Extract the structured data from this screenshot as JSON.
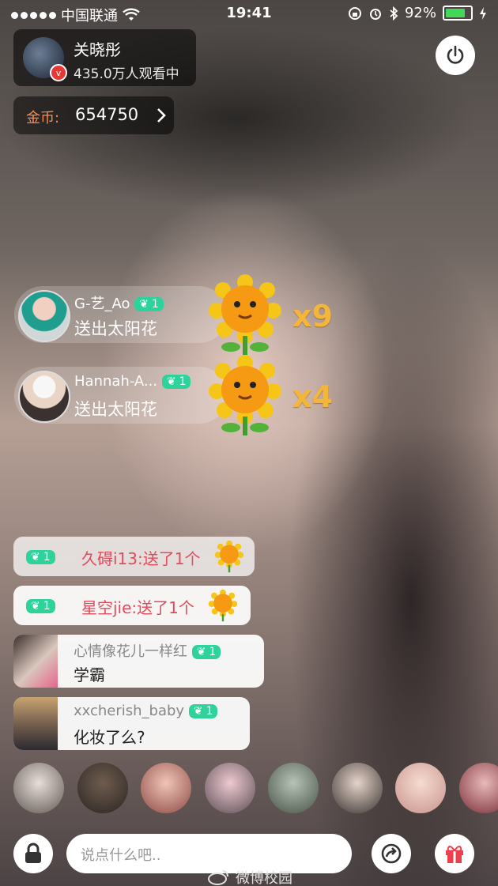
{
  "status_bar": {
    "carrier": "中国联通",
    "time": "19:41",
    "battery": "92%",
    "battery_level": 0.92
  },
  "host": {
    "name": "关晓彤",
    "viewers": "435.0万人观看中"
  },
  "coins": {
    "label": "金币:",
    "value": "654750"
  },
  "gift_notifications": [
    {
      "username": "G-艺_Ao",
      "level": "1",
      "message": "送出太阳花",
      "count": "x9"
    },
    {
      "username": "Hannah-A...",
      "level": "1",
      "message": "送出太阳花",
      "count": "x4"
    }
  ],
  "system_messages": [
    {
      "level": "1",
      "text": "久碍i13:送了1个"
    },
    {
      "level": "1",
      "text": "星空jie:送了1个"
    }
  ],
  "chat_messages": [
    {
      "username": "心情像花儿一样红",
      "level": "1",
      "text": "学霸"
    },
    {
      "username": "xxcherish_baby",
      "level": "1",
      "text": "化妆了么?"
    }
  ],
  "viewer_avatars_count": 8,
  "input": {
    "placeholder": "说点什么吧.."
  },
  "watermark": "微博校园",
  "colors": {
    "level_badge": "#2ed39c",
    "coin_label": "#ff8a4c",
    "gift_text": "#e34b5b",
    "multiplier": "#f3b63b"
  }
}
